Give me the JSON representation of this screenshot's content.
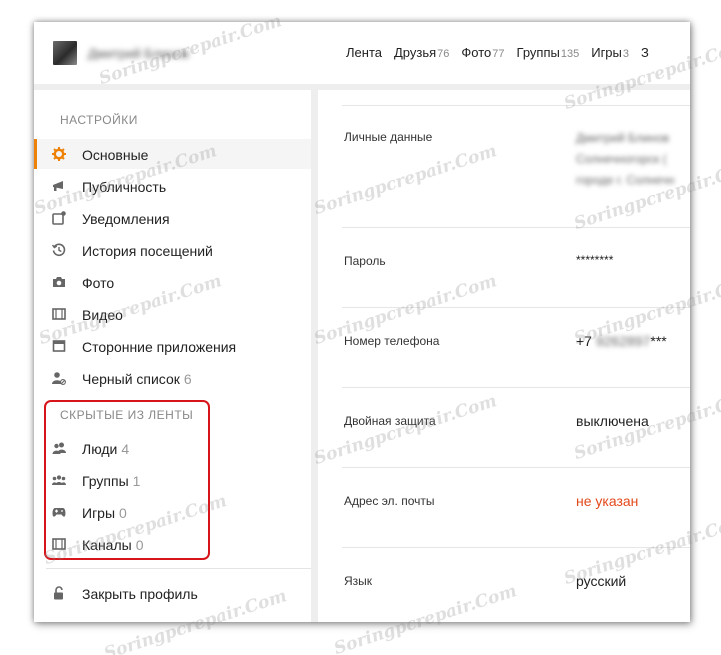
{
  "header": {
    "user_name": "Дмитрий Блинов",
    "nav": [
      {
        "label": "Лента",
        "count": ""
      },
      {
        "label": "Друзья",
        "count": "76"
      },
      {
        "label": "Фото",
        "count": "77"
      },
      {
        "label": "Группы",
        "count": "135"
      },
      {
        "label": "Игры",
        "count": "3"
      },
      {
        "label": "З",
        "count": ""
      }
    ]
  },
  "sidebar": {
    "settings_title": "НАСТРОЙКИ",
    "items": [
      {
        "label": "Основные",
        "count": "",
        "icon": "gear-icon"
      },
      {
        "label": "Публичность",
        "count": "",
        "icon": "megaphone-icon"
      },
      {
        "label": "Уведомления",
        "count": "",
        "icon": "notification-icon"
      },
      {
        "label": "История посещений",
        "count": "",
        "icon": "history-icon"
      },
      {
        "label": "Фото",
        "count": "",
        "icon": "camera-icon"
      },
      {
        "label": "Видео",
        "count": "",
        "icon": "film-icon"
      },
      {
        "label": "Сторонние приложения",
        "count": "",
        "icon": "apps-icon"
      },
      {
        "label": "Черный список",
        "count": "6",
        "icon": "blocked-user-icon"
      }
    ],
    "hidden_title": "СКРЫТЫЕ ИЗ ЛЕНТЫ",
    "hidden_items": [
      {
        "label": "Люди",
        "count": "4",
        "icon": "people-icon"
      },
      {
        "label": "Группы",
        "count": "1",
        "icon": "groups-icon"
      },
      {
        "label": "Игры",
        "count": "0",
        "icon": "gamepad-icon"
      },
      {
        "label": "Каналы",
        "count": "0",
        "icon": "channel-icon"
      }
    ],
    "close_profile": "Закрыть профиль"
  },
  "main": {
    "rows": [
      {
        "label": "Личные данные",
        "value_lines": [
          "Дмитрий Блинов",
          "Солнечногорск (",
          "городе г. Солнечн"
        ]
      },
      {
        "label": "Пароль",
        "value": "********"
      },
      {
        "label": "Номер телефона",
        "value_prefix": "+7",
        "value_hidden": "9262897",
        "value_suffix": "***"
      },
      {
        "label": "Двойная защита",
        "value": "выключена"
      },
      {
        "label": "Адрес эл. почты",
        "value": "не указан"
      },
      {
        "label": "Язык",
        "value": "русский"
      }
    ]
  },
  "watermark": "Soringpcrepair.Com",
  "colors": {
    "accent": "#ee8208",
    "highlight": "#d7141a",
    "warning": "#e3481b"
  }
}
